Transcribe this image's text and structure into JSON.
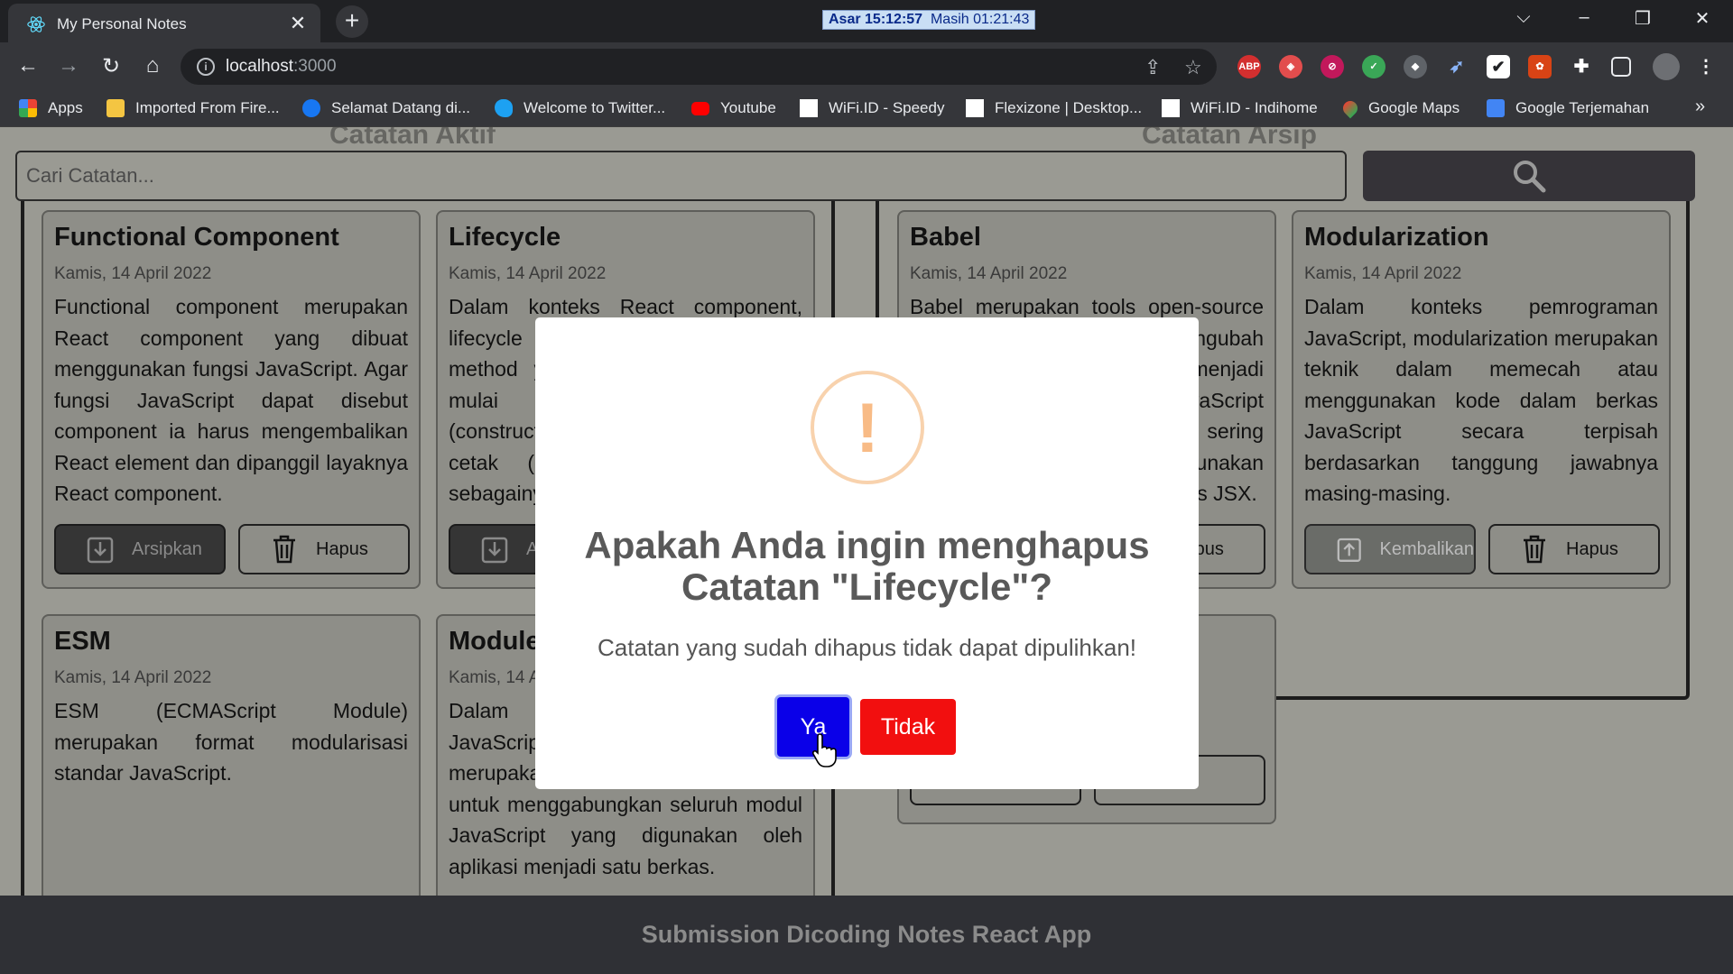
{
  "browser": {
    "tab_title": "My Personal Notes",
    "new_tab": "+",
    "close_tab": "✕",
    "prayer_time": "Asar 15:12:57",
    "prayer_remaining": "Masih 01:21:43",
    "url_host": "localhost",
    "url_port": ":3000",
    "bookmarks": [
      {
        "label": "Apps",
        "icon": "apps-grid-icon",
        "color": "#4285f4"
      },
      {
        "label": "Imported From Fire...",
        "icon": "folder-icon",
        "color": "#f4c542"
      },
      {
        "label": "Selamat Datang di...",
        "icon": "facebook-icon",
        "color": "#1877f2"
      },
      {
        "label": "Welcome to Twitter...",
        "icon": "twitter-icon",
        "color": "#1da1f2"
      },
      {
        "label": "Youtube",
        "icon": "youtube-icon",
        "color": "#ff0000"
      },
      {
        "label": "WiFi.ID - Speedy",
        "icon": "page-icon",
        "color": "#ffffff"
      },
      {
        "label": "Flexizone | Desktop...",
        "icon": "page-icon",
        "color": "#ffffff"
      },
      {
        "label": "WiFi.ID - Indihome",
        "icon": "page-icon",
        "color": "#ffffff"
      },
      {
        "label": "Google Maps",
        "icon": "maps-pin-icon",
        "color": "#34a853"
      },
      {
        "label": "Google Terjemahan",
        "icon": "translate-icon",
        "color": "#4285f4"
      }
    ],
    "bookmarks_more": "»"
  },
  "app": {
    "sections": {
      "active": "Catatan Aktif",
      "archived": "Catatan Arsip"
    },
    "search": {
      "placeholder": "Cari Catatan..."
    },
    "footer": "Submission Dicoding Notes React App",
    "buttons": {
      "archive": "Arsipkan",
      "delete": "Hapus",
      "restore": "Kembalikan"
    },
    "active_notes": [
      {
        "title": "Functional Component",
        "date": "Kamis, 14 April 2022",
        "body": "Functional component merupakan React component yang dibuat menggunakan fungsi JavaScript. Agar fungsi JavaScript dapat disebut component ia harus mengembalikan React element dan dipanggil layaknya React component."
      },
      {
        "title": "Lifecycle",
        "date": "Kamis, 14 April 2022",
        "body": "Dalam konteks React component, lifecycle merupakan kumpulan method yang menjadi siklus hidup mulai dari component dibuat (constructor), dicetak (render), pasca-cetak (componentDidMount), dan sebagainya."
      },
      {
        "title": "ESM",
        "date": "Kamis, 14 April 2022",
        "body": "ESM (ECMAScript Module) merupakan format modularisasi standar JavaScript."
      },
      {
        "title": "Module Bundler",
        "date": "Kamis, 14 April 2022",
        "body": "Dalam konteks pemrograman JavaScript, module bundler merupakan tools yang digunakan untuk menggabungkan seluruh modul JavaScript yang digunakan oleh aplikasi menjadi satu berkas."
      }
    ],
    "archived_notes": [
      {
        "title": "Babel",
        "date": "Kamis, 14 April 2022",
        "body": "Babel merupakan tools open-source yang digunakan untuk mengubah sintaks ECMAScript 2015+ menjadi sintaks yang didukung oleh JavaScript engine versi lama. Babel sering dipakai ketika kita menggunakan sintaks terbaru termasuk sintaks JSX."
      },
      {
        "title": "Modularization",
        "date": "Kamis, 14 April 2022",
        "body": "Dalam konteks pemrograman JavaScript, modularization merupakan teknik dalam memecah atau menggunakan kode dalam berkas JavaScript secara terpisah berdasarkan tanggung jawabnya masing-masing."
      }
    ]
  },
  "dialog": {
    "icon": "!",
    "title": "Apakah Anda ingin menghapus Catatan \"Lifecycle\"?",
    "text": "Catatan yang sudah dihapus tidak dapat dipulihkan!",
    "confirm": "Ya",
    "cancel": "Tidak",
    "confirm_color": "#0a00e8",
    "cancel_color": "#f20f0f"
  }
}
